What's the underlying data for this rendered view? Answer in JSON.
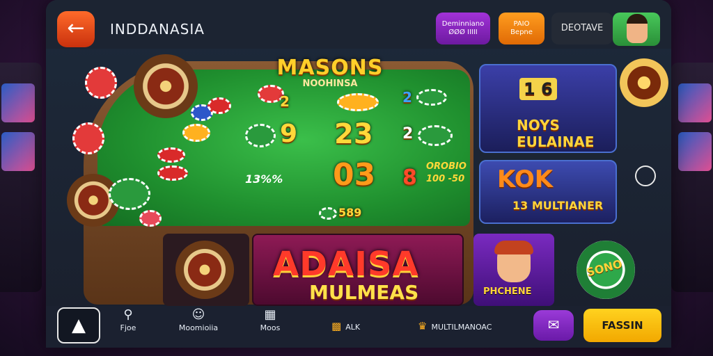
{
  "header": {
    "back_icon": "arrow-left-icon",
    "title": "INDDANASIA",
    "button_1": "Deminniano\nØØØ IIIII",
    "button_2": "PAIO\nBepne",
    "button_3": "DEOTAVE",
    "avatar_icon": "user-avatar-icon"
  },
  "table": {
    "logo_main": "MASONS",
    "logo_sub": "NOOHINSA",
    "bet_1": "2",
    "bet_2": "9",
    "bet_3": "23",
    "bet_4": "2",
    "bet_5": "13%%",
    "bet_6": "03",
    "bet_7": "8",
    "odds_top": "OROBIO",
    "odds_bottom": "100 -50",
    "bet_8": "589"
  },
  "cards": {
    "card_1_title": "NOYS EULAINAE",
    "card_1_numbers": "1 6",
    "card_2_title": "KOK",
    "card_2_sub": "13 MULTIANER",
    "banner_main": "ADAISA",
    "banner_sub": "MULMEAS",
    "character_card": "PHCHENE",
    "chip_label": "SONO"
  },
  "nav": {
    "items": [
      {
        "icon": "home-icon",
        "label": ""
      },
      {
        "icon": "search-icon",
        "label": "Fjoe"
      },
      {
        "icon": "smiley-icon",
        "label": "Moomioiia"
      },
      {
        "icon": "film-icon",
        "label": "Moos"
      },
      {
        "icon": "trophy-icon",
        "label": "ALK"
      },
      {
        "icon": "crown-icon",
        "label": "MULTILMANOAC"
      }
    ],
    "chat_icon": "chat-icon",
    "cta": "FASSIN"
  },
  "colors": {
    "accent": "#ff6a2a",
    "cta": "#ffd21f",
    "felt": "#1f8f2e",
    "purple": "#9a3ad8"
  }
}
